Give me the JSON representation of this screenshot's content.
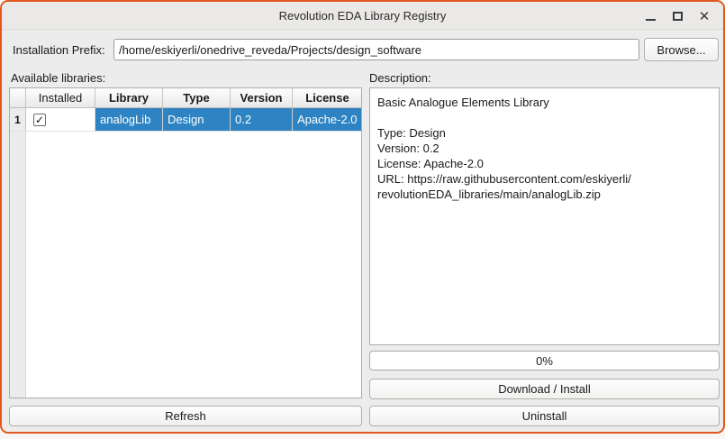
{
  "window": {
    "title": "Revolution EDA Library Registry",
    "controls": {
      "close": "✕"
    }
  },
  "prefix": {
    "label": "Installation Prefix:",
    "value": "/home/eskiyerli/onedrive_reveda/Projects/design_software",
    "browse_label": "Browse..."
  },
  "libraries": {
    "label": "Available libraries:",
    "columns": {
      "installed": "Installed",
      "library": "Library",
      "type": "Type",
      "version": "Version",
      "license": "License"
    },
    "rows": [
      {
        "row_number": "1",
        "installed": true,
        "library": "analogLib",
        "type": "Design",
        "version": "0.2",
        "license": "Apache-2.0",
        "selected": true
      }
    ],
    "refresh_label": "Refresh"
  },
  "description": {
    "label": "Description:",
    "lines": [
      "Basic Analogue Elements Library",
      "",
      "Type: Design",
      "Version: 0.2",
      "License: Apache-2.0",
      "URL: https://raw.githubusercontent.com/eskiyerli/",
      "revolutionEDA_libraries/main/analogLib.zip"
    ]
  },
  "actions": {
    "progress": "0%",
    "download_install": "Download / Install",
    "uninstall": "Uninstall"
  },
  "icons": {
    "check": "✓"
  },
  "colors": {
    "selection_blue": "#2e84c2",
    "window_border_orange": "#e2571e",
    "window_background": "#ececec"
  }
}
